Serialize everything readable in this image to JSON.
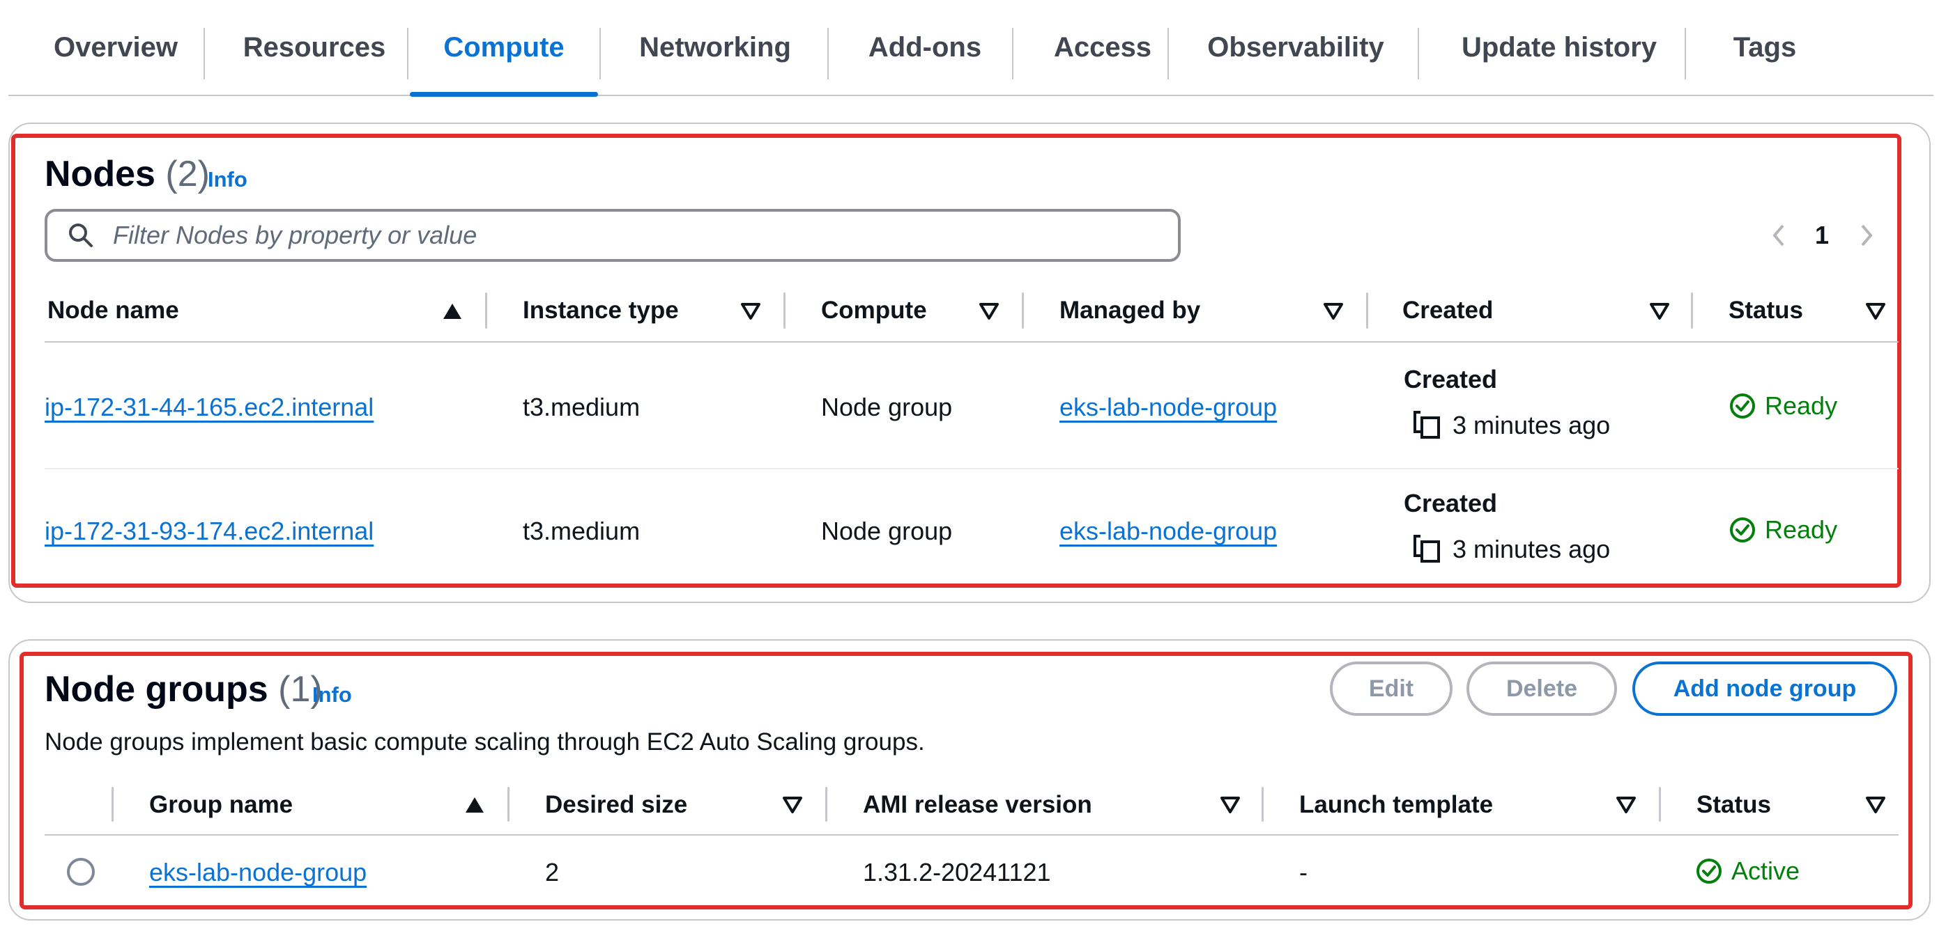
{
  "tabs": [
    {
      "label": "Overview"
    },
    {
      "label": "Resources"
    },
    {
      "label": "Compute",
      "active": true
    },
    {
      "label": "Networking"
    },
    {
      "label": "Add-ons"
    },
    {
      "label": "Access"
    },
    {
      "label": "Observability"
    },
    {
      "label": "Update history"
    },
    {
      "label": "Tags"
    }
  ],
  "nodes": {
    "title": "Nodes",
    "count": "(2)",
    "info": "Info",
    "filter_placeholder": "Filter Nodes by property or value",
    "page": "1",
    "columns": [
      "Node name",
      "Instance type",
      "Compute",
      "Managed by",
      "Created",
      "Status"
    ],
    "rows": [
      {
        "name": "ip-172-31-44-165.ec2.internal",
        "instance_type": "t3.medium",
        "compute": "Node group",
        "managed_by": "eks-lab-node-group",
        "created_label": "Created",
        "created_time": "3 minutes ago",
        "status": "Ready"
      },
      {
        "name": "ip-172-31-93-174.ec2.internal",
        "instance_type": "t3.medium",
        "compute": "Node group",
        "managed_by": "eks-lab-node-group",
        "created_label": "Created",
        "created_time": "3 minutes ago",
        "status": "Ready"
      }
    ]
  },
  "node_groups": {
    "title": "Node groups",
    "count": "(1)",
    "info": "Info",
    "description": "Node groups implement basic compute scaling through EC2 Auto Scaling groups.",
    "buttons": {
      "edit": "Edit",
      "delete": "Delete",
      "add": "Add node group"
    },
    "columns": [
      "Group name",
      "Desired size",
      "AMI release version",
      "Launch template",
      "Status"
    ],
    "rows": [
      {
        "name": "eks-lab-node-group",
        "desired_size": "2",
        "ami_version": "1.31.2-20241121",
        "launch_template": "-",
        "status": "Active"
      }
    ]
  },
  "colors": {
    "accent": "#0972d3",
    "success": "#037f0c",
    "highlight": "#e22d2d"
  }
}
